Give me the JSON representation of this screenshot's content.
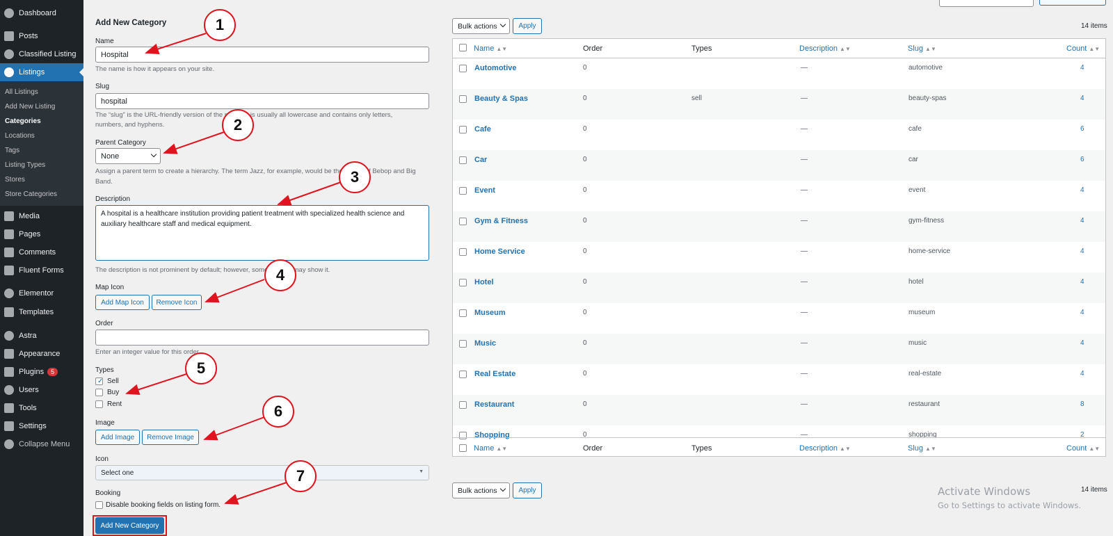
{
  "sidebar": {
    "items": [
      {
        "label": "Dashboard",
        "icon": "dashboard-icon"
      },
      {
        "label": "Posts",
        "icon": "pin-icon"
      },
      {
        "label": "Classified Listing",
        "icon": "location-icon"
      },
      {
        "label": "Listings",
        "icon": "location-icon"
      },
      {
        "label": "Media",
        "icon": "media-icon"
      },
      {
        "label": "Pages",
        "icon": "pages-icon"
      },
      {
        "label": "Comments",
        "icon": "comments-icon"
      },
      {
        "label": "Fluent Forms",
        "icon": "forms-icon"
      },
      {
        "label": "Elementor",
        "icon": "elementor-icon"
      },
      {
        "label": "Templates",
        "icon": "folder-icon"
      },
      {
        "label": "Astra",
        "icon": "astra-icon"
      },
      {
        "label": "Appearance",
        "icon": "brush-icon"
      },
      {
        "label": "Plugins",
        "icon": "plugin-icon",
        "badge": "5"
      },
      {
        "label": "Users",
        "icon": "user-icon"
      },
      {
        "label": "Tools",
        "icon": "wrench-icon"
      },
      {
        "label": "Settings",
        "icon": "settings-icon"
      },
      {
        "label": "Collapse Menu",
        "icon": "collapse-icon"
      }
    ],
    "submenu": [
      "All Listings",
      "Add New Listing",
      "Categories",
      "Locations",
      "Tags",
      "Listing Types",
      "Stores",
      "Store Categories"
    ]
  },
  "form": {
    "heading": "Add New Category",
    "name_label": "Name",
    "name_value": "Hospital",
    "name_desc": "The name is how it appears on your site.",
    "slug_label": "Slug",
    "slug_value": "hospital",
    "slug_desc_1": "The “slug” is the URL-friendly version of the name. It is usually all lowercase and contains only letters,",
    "slug_desc_2": "numbers, and hyphens.",
    "parent_label": "Parent Category",
    "parent_value": "None",
    "parent_desc_1": "Assign a parent term to create a hierarchy. The term Jazz, for example, would be the parent of Bebop and Big",
    "parent_desc_2": "Band.",
    "description_label": "Description",
    "description_value": "A hospital is a healthcare institution providing patient treatment with specialized health science and auxiliary healthcare staff and medical equipment.",
    "description_desc": "The description is not prominent by default; however, some themes may show it.",
    "map_icon_label": "Map Icon",
    "add_map_icon": "Add Map Icon",
    "remove_icon": "Remove Icon",
    "order_label": "Order",
    "order_desc": "Enter an integer value for this order.",
    "types_label": "Types",
    "types": [
      {
        "label": "Sell",
        "checked": true
      },
      {
        "label": "Buy",
        "checked": false
      },
      {
        "label": "Rent",
        "checked": false
      }
    ],
    "image_label": "Image",
    "add_image": "Add Image",
    "remove_image": "Remove Image",
    "icon_label": "Icon",
    "icon_value": "Select one",
    "booking_label": "Booking",
    "booking_check": "Disable booking fields on listing form.",
    "submit": "Add New Category"
  },
  "top": {
    "bulk": "Bulk actions",
    "apply": "Apply",
    "items": "14 items"
  },
  "table": {
    "headers": [
      "Name",
      "Order",
      "Types",
      "Description",
      "Slug",
      "Count"
    ],
    "rows": [
      {
        "name": "Automotive",
        "order": "0",
        "types": "",
        "desc": "—",
        "slug": "automotive",
        "count": "4"
      },
      {
        "name": "Beauty & Spas",
        "order": "0",
        "types": "sell",
        "desc": "—",
        "slug": "beauty-spas",
        "count": "4"
      },
      {
        "name": "Cafe",
        "order": "0",
        "types": "",
        "desc": "—",
        "slug": "cafe",
        "count": "6"
      },
      {
        "name": "Car",
        "order": "0",
        "types": "",
        "desc": "—",
        "slug": "car",
        "count": "6"
      },
      {
        "name": "Event",
        "order": "0",
        "types": "",
        "desc": "—",
        "slug": "event",
        "count": "4"
      },
      {
        "name": "Gym & Fitness",
        "order": "0",
        "types": "",
        "desc": "—",
        "slug": "gym-fitness",
        "count": "4"
      },
      {
        "name": "Home Service",
        "order": "0",
        "types": "",
        "desc": "—",
        "slug": "home-service",
        "count": "4"
      },
      {
        "name": "Hotel",
        "order": "0",
        "types": "",
        "desc": "—",
        "slug": "hotel",
        "count": "4"
      },
      {
        "name": "Museum",
        "order": "0",
        "types": "",
        "desc": "—",
        "slug": "museum",
        "count": "4"
      },
      {
        "name": "Music",
        "order": "0",
        "types": "",
        "desc": "—",
        "slug": "music",
        "count": "4"
      },
      {
        "name": "Real Estate",
        "order": "0",
        "types": "",
        "desc": "—",
        "slug": "real-estate",
        "count": "4"
      },
      {
        "name": "Restaurant",
        "order": "0",
        "types": "",
        "desc": "—",
        "slug": "restaurant",
        "count": "8"
      },
      {
        "name": "Shopping",
        "order": "0",
        "types": "",
        "desc": "—",
        "slug": "shopping",
        "count": "2"
      }
    ]
  },
  "annotations": [
    "1",
    "2",
    "3",
    "4",
    "5",
    "6",
    "7"
  ],
  "watermark": {
    "title": "Activate Windows",
    "sub": "Go to Settings to activate Windows."
  },
  "colors": {
    "accent": "#2271b1",
    "annotation": "#e0141e",
    "sidebar": "#1d2327"
  }
}
